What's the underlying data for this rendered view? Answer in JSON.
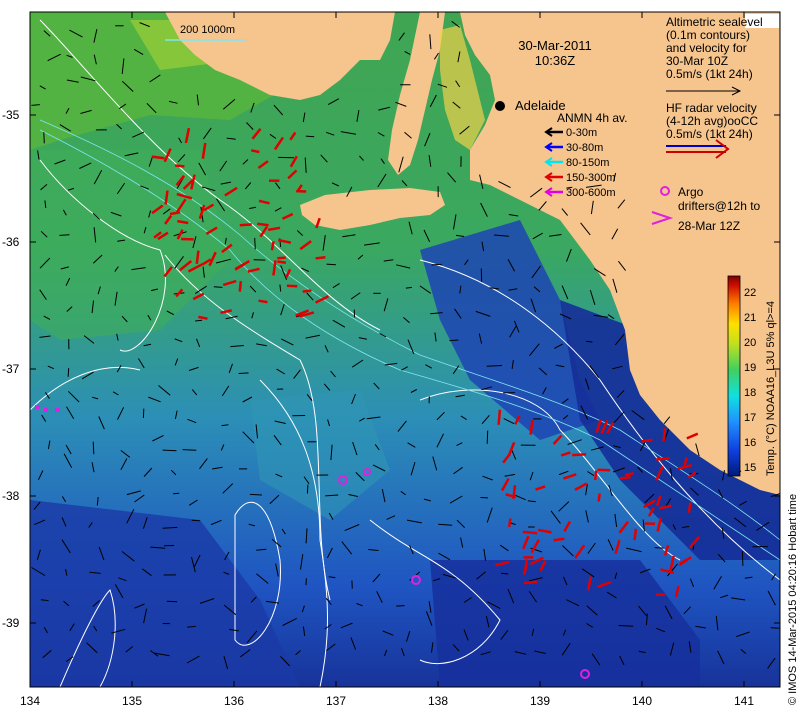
{
  "map": {
    "date": "30-Mar-2011",
    "time": "10:36Z",
    "city": "Adelaide",
    "scale_bar_label": "200  1000m",
    "lon_ticks": [
      "134",
      "135",
      "136",
      "137",
      "138",
      "139",
      "140",
      "141"
    ],
    "lat_ticks": [
      "-35",
      "-36",
      "-37",
      "-38",
      "-39"
    ]
  },
  "legend_altimetry": {
    "lines": [
      "Altimetric sealevel",
      "(0.1m contours)",
      "and velocity for",
      "30-Mar 10Z",
      "0.5m/s (1kt 24h)"
    ]
  },
  "legend_hf": {
    "lines": [
      "HF radar velocity",
      "(4-12h avg)ooCC",
      "0.5m/s (1kt 24h)"
    ],
    "colors": [
      "#0000cc",
      "#cc0000"
    ]
  },
  "legend_anmn": {
    "title": "ANMN 4h av.",
    "items": [
      {
        "label": "0-30m",
        "color": "#000000"
      },
      {
        "label": "30-80m",
        "color": "#0000ff"
      },
      {
        "label": "80-150m",
        "color": "#00e5ee"
      },
      {
        "label": "150-300m",
        "color": "#e00000"
      },
      {
        "label": "300-600m",
        "color": "#e000e0"
      }
    ]
  },
  "legend_argo": {
    "lines": [
      "Argo",
      "drifters@12h to",
      "28-Mar 12Z"
    ],
    "color": "#e020e0"
  },
  "colorbar": {
    "label": "Temp. (°C) NOAA16_L3U 5% ql>=4",
    "ticks": [
      "22",
      "21",
      "20",
      "19",
      "18",
      "17",
      "16",
      "15"
    ]
  },
  "credit": "© IMOS 14-Mar-2015 04:20:16 Hobart time"
}
